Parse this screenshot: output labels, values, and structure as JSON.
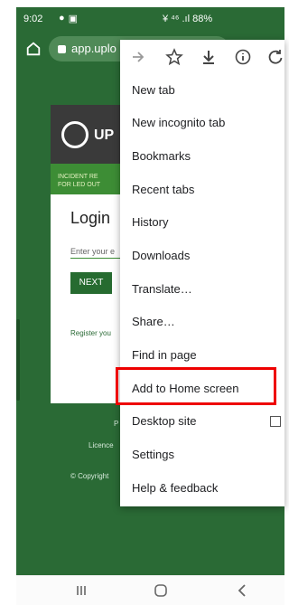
{
  "status_bar": {
    "time": "9:02",
    "right": "¥ ⁴⁶ .ıl 88%",
    "battery": "88%"
  },
  "browser": {
    "url": "app.uplo"
  },
  "page": {
    "brand": "UP",
    "banner_line1": "INCIDENT RE",
    "banner_line2": "FOR LED OUT",
    "login_title": "Login",
    "input_placeholder": "Enter your e",
    "next_button": "NEXT",
    "register_text": "Register you",
    "footer_p": "P",
    "footer_licence": "Licence",
    "footer_copyright": "© Copyright"
  },
  "menu": {
    "items": [
      {
        "label": "New tab"
      },
      {
        "label": "New incognito tab"
      },
      {
        "label": "Bookmarks"
      },
      {
        "label": "Recent tabs"
      },
      {
        "label": "History"
      },
      {
        "label": "Downloads"
      },
      {
        "label": "Translate…"
      },
      {
        "label": "Share…"
      },
      {
        "label": "Find in page"
      },
      {
        "label": "Add to Home screen"
      },
      {
        "label": "Desktop site"
      },
      {
        "label": "Settings"
      },
      {
        "label": "Help & feedback"
      }
    ]
  },
  "icons": {
    "forward": "forward-icon",
    "bookmark": "star-icon",
    "download": "download-icon",
    "info": "info-icon",
    "refresh": "refresh-icon"
  },
  "colors": {
    "page_green": "#2a6a35",
    "highlight_red": "#e00000"
  }
}
